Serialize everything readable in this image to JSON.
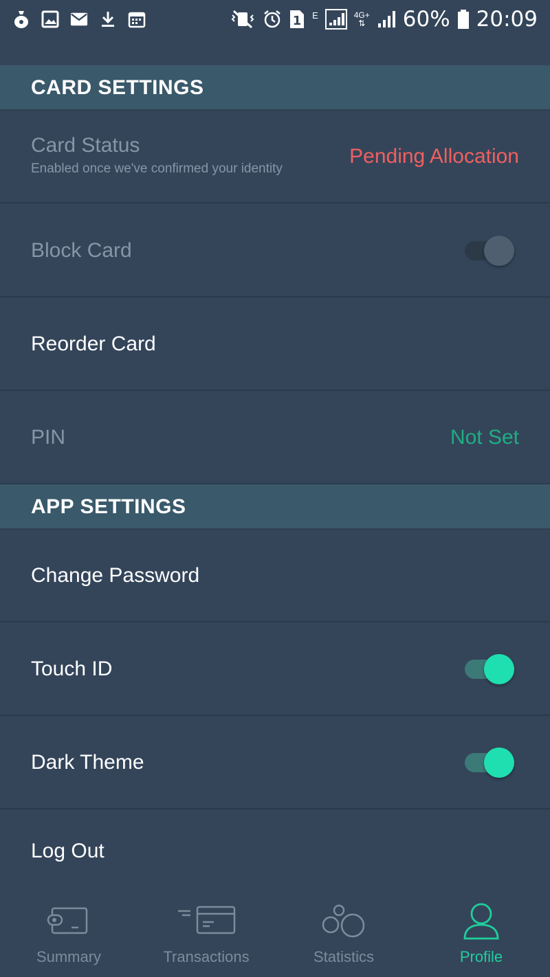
{
  "status_bar": {
    "left_icons": [
      "money-bag-icon",
      "image-icon",
      "mail-icon",
      "download-icon",
      "calendar-icon"
    ],
    "sim_label": "1",
    "network_label": "E",
    "lte_label": "4G+",
    "battery": "60%",
    "time": "20:09"
  },
  "card_settings": {
    "header": "CARD SETTINGS",
    "card_status": {
      "label": "Card Status",
      "subtitle": "Enabled once we've confirmed your identity",
      "value": "Pending Allocation",
      "value_color": "#f0605f"
    },
    "block_card": {
      "label": "Block Card",
      "enabled": false
    },
    "reorder_card": {
      "label": "Reorder Card"
    },
    "pin": {
      "label": "PIN",
      "value": "Not Set",
      "value_color": "#1fae83"
    }
  },
  "app_settings": {
    "header": "APP SETTINGS",
    "change_password": {
      "label": "Change Password"
    },
    "touch_id": {
      "label": "Touch ID",
      "enabled": true
    },
    "dark_theme": {
      "label": "Dark Theme",
      "enabled": true
    },
    "log_out": {
      "label": "Log Out"
    }
  },
  "tabbar": {
    "tabs": [
      {
        "label": "Summary",
        "icon": "wallet-icon",
        "active": false
      },
      {
        "label": "Transactions",
        "icon": "card-icon",
        "active": false
      },
      {
        "label": "Statistics",
        "icon": "bubbles-icon",
        "active": false
      },
      {
        "label": "Profile",
        "icon": "person-icon",
        "active": true
      }
    ],
    "active_color": "#1fcf9c"
  }
}
